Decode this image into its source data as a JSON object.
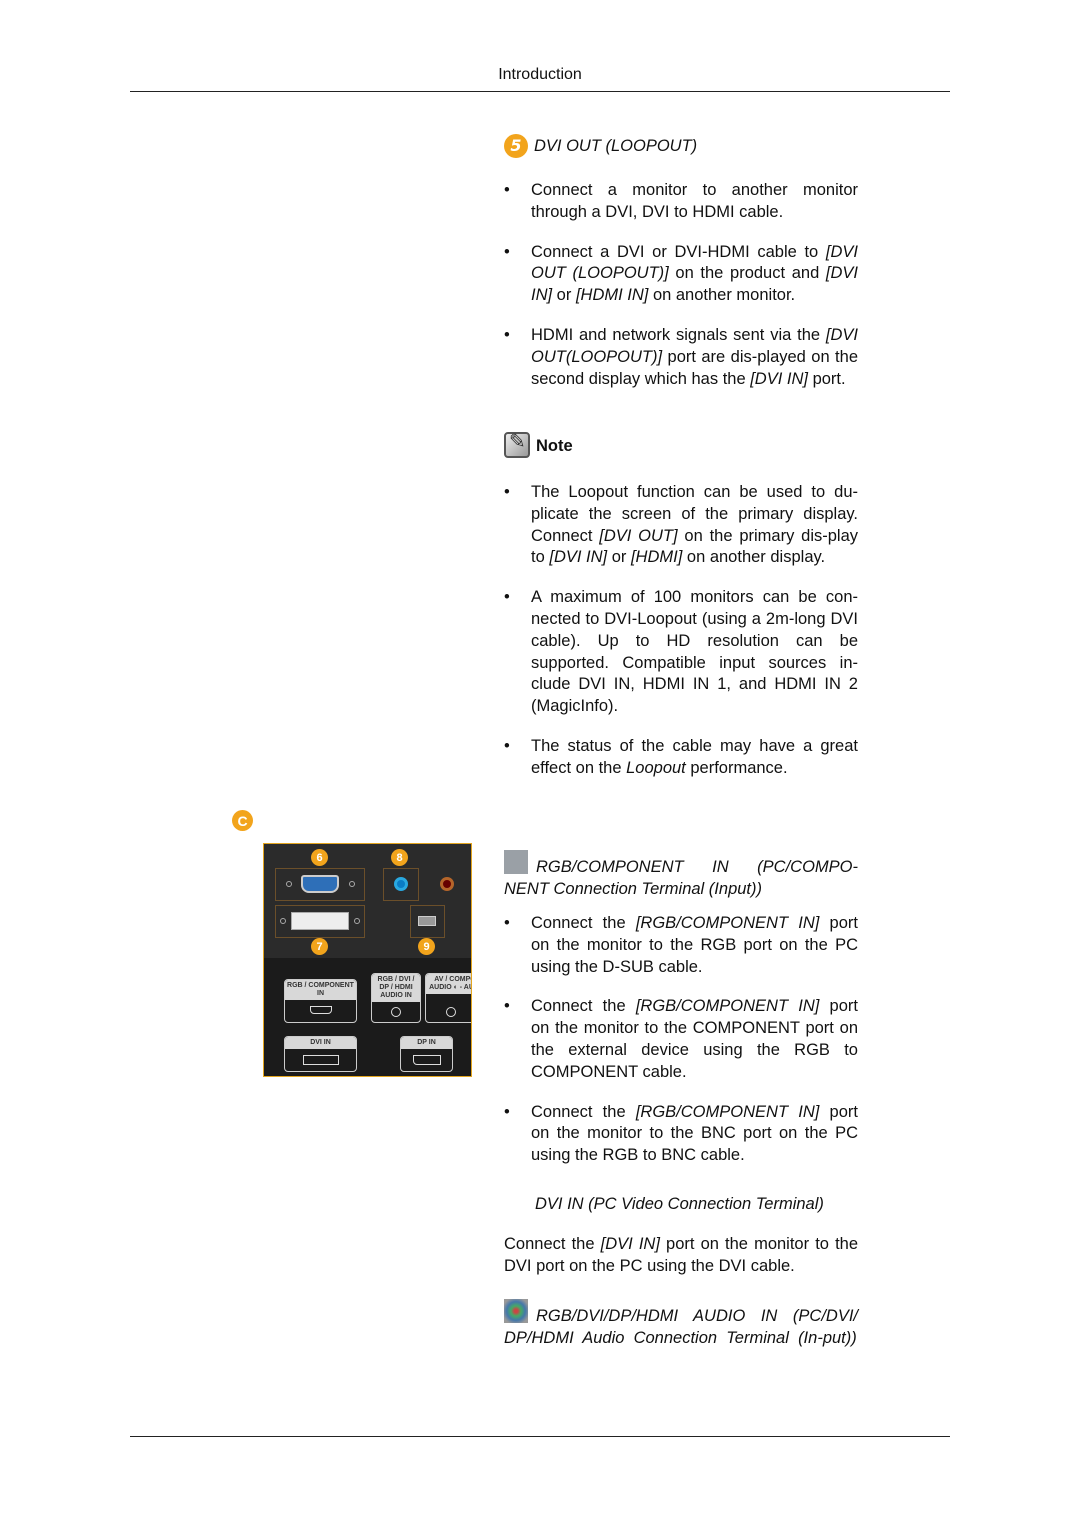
{
  "header": {
    "title": "Introduction"
  },
  "section5": {
    "badge": "5",
    "title": "DVI OUT (LOOPOUT)",
    "bullets": [
      "Connect a monitor to another monitor through a DVI, DVI to HDMI cable.",
      "Connect a DVI or DVI-HDMI cable to [DVI OUT (LOOPOUT)] on the product and [DVI IN] or [HDMI IN] on another monitor.",
      "HDMI and network signals sent via the [DVI OUT(LOOPOUT)] port are dis-played on the second display which has the [DVI IN] port."
    ]
  },
  "note": {
    "label": "Note",
    "bullets": [
      "The Loopout function can be used to du-plicate the screen of the primary display. Connect [DVI OUT] on the primary dis-play to [DVI IN] or [HDMI] on another display.",
      "A maximum of 100 monitors can be con-nected to DVI-Loopout (using a 2m-long DVI cable). Up to HD resolution can be supported. Compatible input sources in-clude DVI IN, HDMI IN 1, and HDMI IN 2 (MagicInfo).",
      "The status of the cable may have a great effect on the Loopout performance."
    ]
  },
  "rgb_section": {
    "title": "RGB/COMPONENT IN (PC/COMPO-NENT Connection Terminal (Input))",
    "bullets": [
      "Connect the [RGB/COMPONENT IN] port on the monitor to the RGB port on the PC using the D-SUB cable.",
      "Connect the [RGB/COMPONENT IN] port on the monitor to the COMPONENT port on the external device using the RGB to COMPONENT cable.",
      "Connect the [RGB/COMPONENT IN] port on the monitor to the BNC port on the PC using the RGB to BNC cable."
    ]
  },
  "dvi_in_section": {
    "title": "DVI IN (PC Video Connection Terminal)",
    "body": "Connect the [DVI IN] port on the monitor to the DVI port on the PC using the DVI cable."
  },
  "audio_section": {
    "title": "RGB/DVI/DP/HDMI AUDIO IN (PC/DVI/ DP/HDMI Audio Connection Terminal (In-put))"
  },
  "panel": {
    "section_badge": "C",
    "badges": [
      "6",
      "7",
      "8",
      "9"
    ],
    "labels": {
      "rgb": "RGB / COMPONENT IN",
      "audio": "RGB / DVI / DP / HDMI AUDIO IN",
      "av": "AV / COMPO AUDIO ◐ - AUDI",
      "dvi": "DVI IN",
      "dp": "DP IN"
    }
  }
}
